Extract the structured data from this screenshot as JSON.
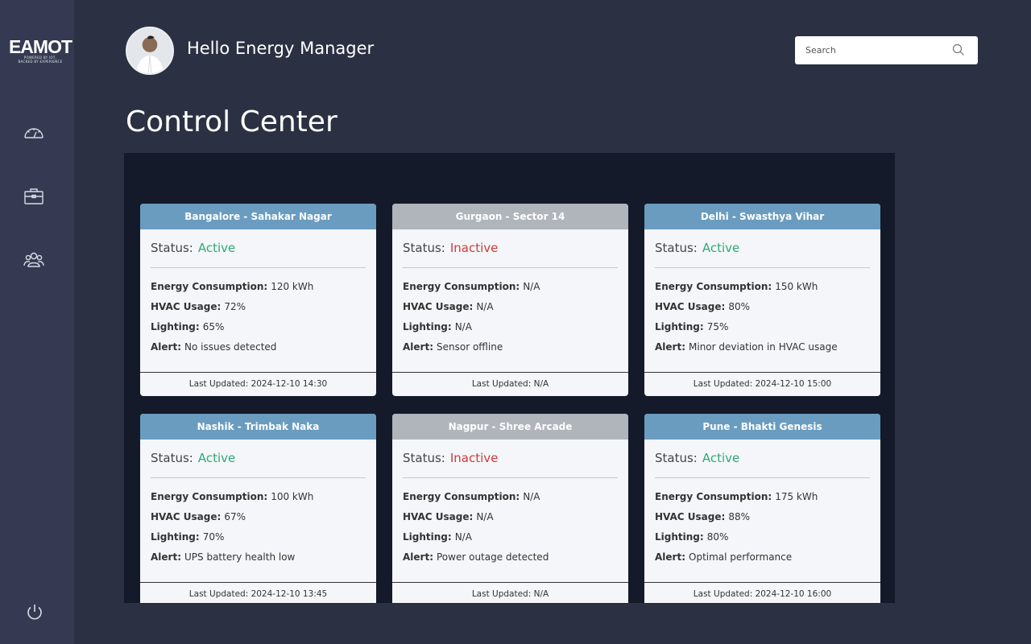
{
  "app": {
    "logo_text": "EAMOT",
    "logo_sub_1": "POWERED BY IOT,",
    "logo_sub_2": "BACKED BY EXPERIENCE"
  },
  "sidebar": {
    "items": [
      {
        "icon": "speedometer-icon"
      },
      {
        "icon": "briefcase-icon"
      },
      {
        "icon": "users-icon"
      }
    ],
    "logout_icon": "power-icon"
  },
  "header": {
    "greeting": "Hello Energy Manager"
  },
  "search": {
    "placeholder": "Search"
  },
  "page": {
    "title": "Control Center"
  },
  "labels": {
    "status": "Status:",
    "energy": "Energy Consumption:",
    "hvac": "HVAC Usage:",
    "lighting": "Lighting:",
    "alert": "Alert:"
  },
  "colors": {
    "active": "#2eaa74",
    "inactive": "#d03a3a",
    "head_active": "#6a9cbf",
    "head_inactive": "#b0b4bb"
  },
  "sites": [
    {
      "name": "Bangalore - Sahakar Nagar",
      "status": "Active",
      "energy": "120 kWh",
      "hvac": "72%",
      "lighting": "65%",
      "alert": "No issues detected",
      "updated": "Last Updated: 2024-12-10 14:30"
    },
    {
      "name": "Gurgaon - Sector 14",
      "status": "Inactive",
      "energy": "N/A",
      "hvac": "N/A",
      "lighting": "N/A",
      "alert": "Sensor offline",
      "updated": "Last Updated: N/A"
    },
    {
      "name": "Delhi - Swasthya Vihar",
      "status": "Active",
      "energy": "150 kWh",
      "hvac": "80%",
      "lighting": "75%",
      "alert": "Minor deviation in HVAC usage",
      "updated": "Last Updated: 2024-12-10 15:00"
    },
    {
      "name": "Nashik - Trimbak Naka",
      "status": "Active",
      "energy": "100 kWh",
      "hvac": "67%",
      "lighting": "70%",
      "alert": "UPS battery health low",
      "updated": "Last Updated: 2024-12-10 13:45"
    },
    {
      "name": "Nagpur - Shree Arcade",
      "status": "Inactive",
      "energy": "N/A",
      "hvac": "N/A",
      "lighting": "N/A",
      "alert": "Power outage detected",
      "updated": "Last Updated: N/A"
    },
    {
      "name": "Pune - Bhakti Genesis",
      "status": "Active",
      "energy": "175 kWh",
      "hvac": "88%",
      "lighting": "80%",
      "alert": "Optimal performance",
      "updated": "Last Updated: 2024-12-10 16:00"
    }
  ]
}
